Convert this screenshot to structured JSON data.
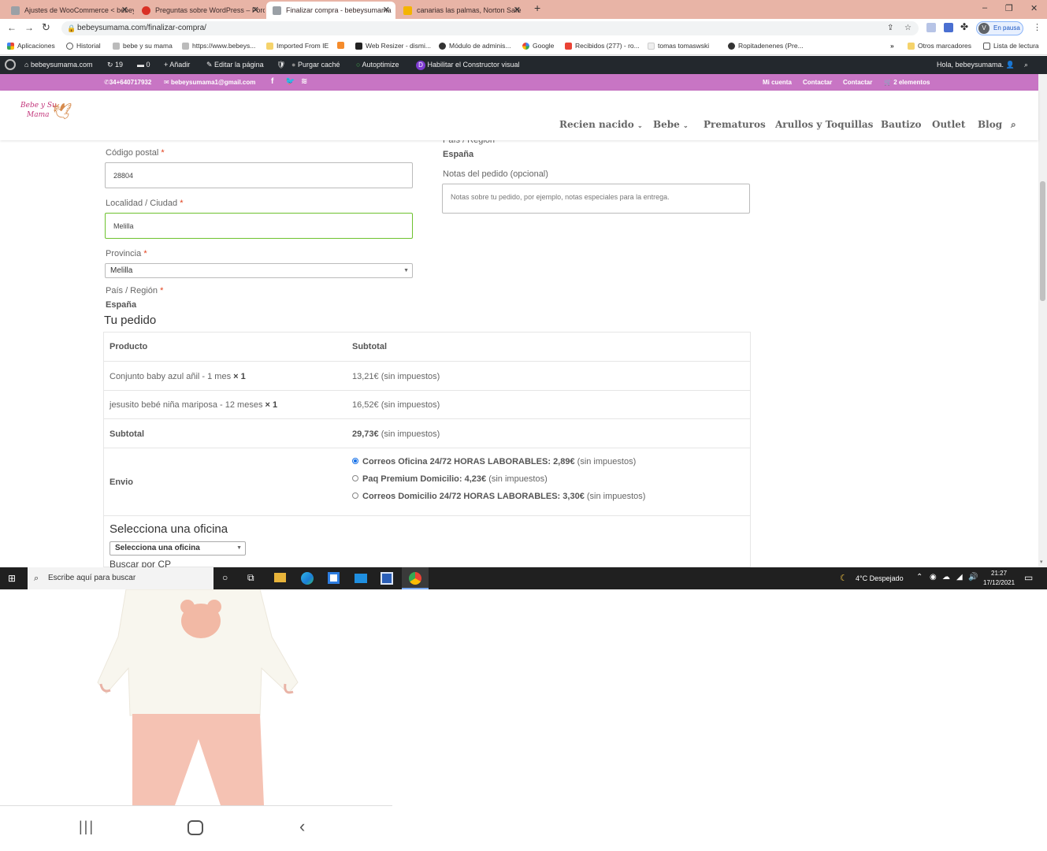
{
  "browser": {
    "tabs": [
      {
        "title": "Ajustes de WooCommerce < bebeys",
        "color": "#9aa0a6"
      },
      {
        "title": "Preguntas sobre WordPress – Foro",
        "color": "#d93025"
      },
      {
        "title": "Finalizar compra - bebeysumama",
        "color": "#9aa0a6"
      },
      {
        "title": "canarias las palmas, Norton Safe",
        "color": "#f4b400"
      }
    ],
    "url": "bebeysumama.com/finalizar-compra/",
    "profile_label": "En pausa",
    "profile_initial": "V",
    "bookmarks": [
      "Aplicaciones",
      "Historial",
      "bebe y su mama",
      "https://www.bebeys...",
      "Imported From IE",
      "Web Resizer - dismi...",
      "Módulo de adminis...",
      "Google",
      "Recibidos (277) - ro...",
      "tomas tomaswski",
      "Ropitadenenes (Pre..."
    ],
    "bookmarks_right": [
      "Otros marcadores",
      "Lista de lectura"
    ]
  },
  "adminbar": {
    "site": "bebeysumama.com",
    "updates": "19",
    "comments": "0",
    "add": "Añadir",
    "edit": "Editar la página",
    "purge": "Purgar caché",
    "autoptimize": "Autoptimize",
    "divi": "Habilitar el Constructor visual",
    "greeting": "Hola, bebeysumama."
  },
  "topbar": {
    "phone": "34+640717932",
    "email": "bebeysumama1@gmail.com",
    "links": [
      "Mi cuenta",
      "Contactar",
      "Contactar"
    ],
    "cart": "2 elementos"
  },
  "logo": {
    "line1": "Bebe y Su",
    "line2": "Mama"
  },
  "nav": [
    "Recien nacido",
    "Bebe",
    "Prematuros",
    "Arullos y Toquillas",
    "Bautizo",
    "Outlet",
    "Blog"
  ],
  "form": {
    "postcode_label": "Código postal",
    "postcode_value": "28804",
    "city_label": "Localidad / Ciudad",
    "city_value": "Melilla",
    "province_label": "Provincia",
    "province_value": "Melilla",
    "country_label": "País / Región",
    "country_value": "España",
    "country_label_right": "País / Región",
    "country_value_right": "España",
    "notes_label": "Notas del pedido (opcional)",
    "notes_placeholder": "Notas sobre tu pedido, por ejemplo, notas especiales para la entrega."
  },
  "order": {
    "heading": "Tu pedido",
    "col_product": "Producto",
    "col_subtotal": "Subtotal",
    "items": [
      {
        "name": "Conjunto baby azul añil - 1 mes",
        "qty": "× 1",
        "price": "13,21€",
        "tax": "(sin impuestos)"
      },
      {
        "name": "jesusito bebé niña mariposa - 12 meses",
        "qty": "× 1",
        "price": "16,52€",
        "tax": "(sin impuestos)"
      }
    ],
    "subtotal_label": "Subtotal",
    "subtotal_value": "29,73€",
    "subtotal_tax": "(sin impuestos)",
    "shipping_label": "Envio",
    "shipping_options": [
      {
        "name": "Correos Oficina 24/72 HORAS LABORABLES:",
        "price": "2,89€",
        "tax": "(sin impuestos)",
        "selected": true
      },
      {
        "name": "Paq Premium Domicilio:",
        "price": "4,23€",
        "tax": "(sin impuestos)",
        "selected": false
      },
      {
        "name": "Correos Domicilio 24/72 HORAS LABORABLES:",
        "price": "3,30€",
        "tax": "(sin impuestos)",
        "selected": false
      }
    ],
    "office_heading": "Selecciona una oficina",
    "office_select": "Selecciona una oficina",
    "search_cp": "Buscar por CP"
  },
  "taskbar": {
    "search_placeholder": "Escribe aquí para buscar",
    "weather": "4°C  Despejado",
    "time": "21:27",
    "date": "17/12/2021"
  },
  "colors": {
    "purple": "#c875c4",
    "adminbar": "#23282d",
    "required": "#e2401c",
    "valid_border": "#6dc22e"
  }
}
